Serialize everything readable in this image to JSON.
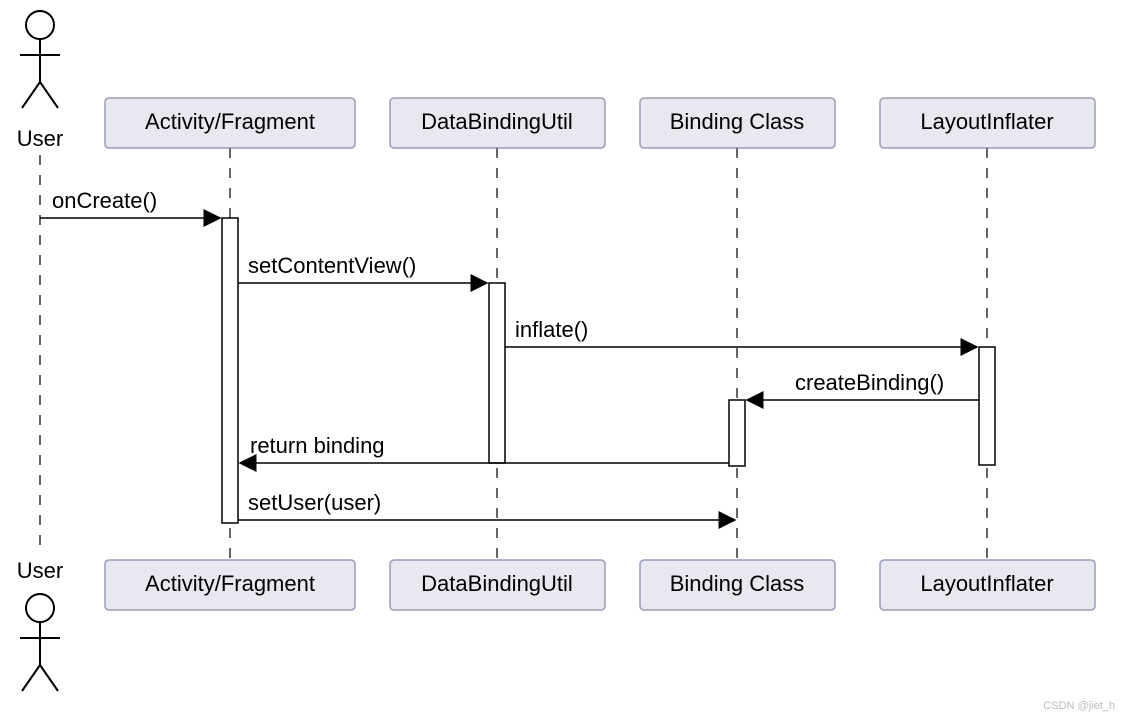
{
  "diagram": {
    "type": "sequence",
    "actor": {
      "name": "User"
    },
    "participants": [
      {
        "id": "activity",
        "label": "Activity/Fragment"
      },
      {
        "id": "dbutil",
        "label": "DataBindingUtil"
      },
      {
        "id": "bclass",
        "label": "Binding Class"
      },
      {
        "id": "inflater",
        "label": "LayoutInflater"
      }
    ],
    "messages": [
      {
        "from": "user",
        "to": "activity",
        "label": "onCreate()",
        "kind": "call"
      },
      {
        "from": "activity",
        "to": "dbutil",
        "label": "setContentView()",
        "kind": "call"
      },
      {
        "from": "dbutil",
        "to": "inflater",
        "label": "inflate()",
        "kind": "call"
      },
      {
        "from": "inflater",
        "to": "bclass",
        "label": "createBinding()",
        "kind": "call"
      },
      {
        "from": "bclass",
        "to": "activity",
        "label": "return binding",
        "kind": "return"
      },
      {
        "from": "activity",
        "to": "bclass",
        "label": "setUser(user)",
        "kind": "call"
      }
    ],
    "watermark": "CSDN @jiet_h"
  }
}
